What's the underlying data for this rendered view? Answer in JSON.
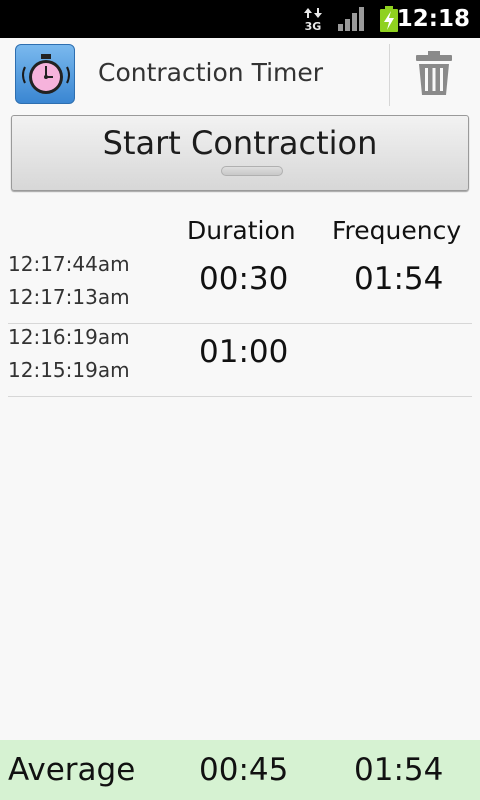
{
  "status_bar": {
    "network": "3G",
    "time": "12:18",
    "icons": [
      "data-transfer-icon",
      "signal-icon",
      "battery-charging-icon"
    ]
  },
  "action_bar": {
    "title": "Contraction Timer",
    "app_icon": "stopwatch-icon",
    "delete_icon": "trash-icon"
  },
  "start_button": {
    "label": "Start Contraction"
  },
  "table": {
    "headers": {
      "duration": "Duration",
      "frequency": "Frequency"
    },
    "rows": [
      {
        "time_end": "12:17:44am",
        "time_start": "12:17:13am",
        "duration": "00:30",
        "frequency": "01:54"
      },
      {
        "time_end": "12:16:19am",
        "time_start": "12:15:19am",
        "duration": "01:00",
        "frequency": ""
      }
    ]
  },
  "average": {
    "label": "Average",
    "duration": "00:45",
    "frequency": "01:54"
  },
  "colors": {
    "status_bar_bg": "#000000",
    "page_bg": "#f8f8f8",
    "average_bg": "#d6f2d2",
    "app_icon_bg": "#4a96de",
    "clock_face": "#f6b3dc",
    "battery": "#8fd11f"
  }
}
